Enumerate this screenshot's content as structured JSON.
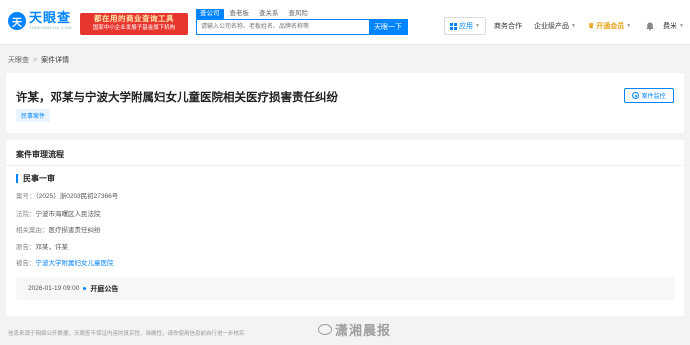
{
  "header": {
    "logo_mark": "天",
    "logo_name": "天眼查",
    "logo_sub": "TIANYANCHA.COM",
    "promo_line1": "都在用的商业查询工具",
    "promo_line2": "国家中小企业发展子基金旗下机构",
    "search_tabs": [
      "查公司",
      "查老板",
      "查关系",
      "查风险"
    ],
    "search_placeholder": "请输入公司名称、老板姓名、品牌名称等",
    "search_button": "天眼一下",
    "app_label": "应用",
    "nav_links": [
      "商务合作",
      "企业级产品"
    ],
    "vip_label": "开通会员",
    "user_name": "费米"
  },
  "breadcrumb": {
    "home": "天眼查",
    "sep": ">",
    "current": "案件详情"
  },
  "case": {
    "title": "许某，邓某与宁波大学附属妇女儿童医院相关医疗损害责任纠纷",
    "tag": "民事案件",
    "monitor_button": "案件监控"
  },
  "flow": {
    "section_title": "案件审理流程",
    "stage_title": "民事一审",
    "rows": [
      {
        "label": "案号：",
        "value": "（2025）浙0203民初27366号"
      },
      {
        "label": "法院：",
        "value": "宁波市海曙区人民法院"
      },
      {
        "label": "相关案由：",
        "value": "医疗损害责任纠纷"
      },
      {
        "label": "原告：",
        "value": "邓某，许某"
      },
      {
        "label": "被告：",
        "value": "宁波大学附属妇女儿童医院"
      }
    ],
    "event_date": "2026-01-19 09:00",
    "event_name": "开庭公告"
  },
  "footer": {
    "note": "信息来源于网络公开数据，天眼查不保证内容的真实性、准确性，请你使用信息前自行进一步核实",
    "watermark": "潇湘晨报"
  }
}
